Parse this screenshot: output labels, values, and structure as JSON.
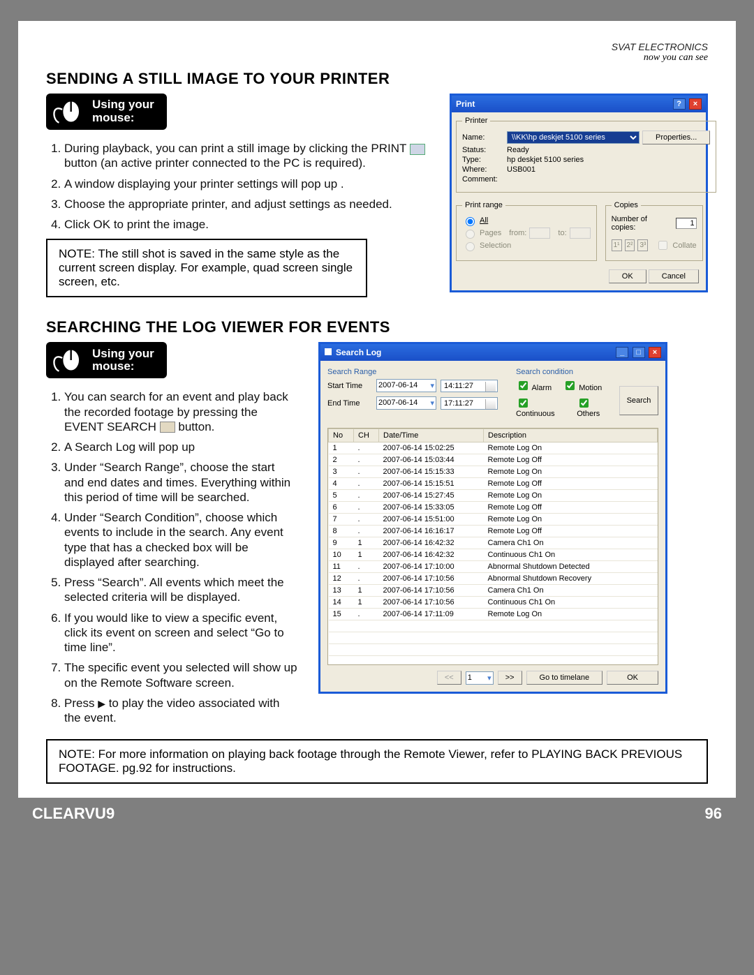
{
  "brand": {
    "name": "SVAT ELECTRONICS",
    "tagline": "now you can see"
  },
  "mouse_label": "Using your\nmouse:",
  "section1": {
    "title": "SENDING A STILL IMAGE TO YOUR PRINTER",
    "steps": [
      "During playback, you can print a still image by clicking the PRINT  ⧉  button (an active printer connected to the PC is required).",
      "A window displaying your printer settings will pop up .",
      "Choose the appropriate printer, and adjust settings as needed.",
      "Click OK to print the image."
    ],
    "note": "NOTE:  The still shot is saved in the same style as the current screen display.  For example, quad screen single screen, etc."
  },
  "section2": {
    "title": "SEARCHING THE LOG VIEWER FOR EVENTS",
    "steps": [
      "You can search for an event and play back the recorded footage by pressing the EVENT SEARCH  ⧉  button.",
      "A Search Log will pop up",
      "Under “Search Range”, choose the start and end dates and times.  Everything within this period of time will be searched.",
      "Under “Search Condition”, choose which events to include in the search.  Any event type that has a checked box will be displayed after searching.",
      "Press “Search”.  All events which meet the selected criteria will be displayed.",
      "If you would like to view a specific event, click its event on screen and select “Go to time line”.",
      "The specific event you selected will show up on the Remote Software screen.",
      "Press ▶ to play the video associated with the event."
    ],
    "note": "NOTE:  For more information on playing back footage through the Remote Viewer, refer to PLAYING BACK PREVIOUS FOOTAGE. pg.92 for instructions."
  },
  "print_dialog": {
    "title": "Print",
    "printer_legend": "Printer",
    "name_label": "Name:",
    "name_value": "\\\\KK\\hp deskjet 5100 series",
    "properties": "Properties...",
    "status_label": "Status:",
    "status_value": "Ready",
    "type_label": "Type:",
    "type_value": "hp deskjet 5100 series",
    "where_label": "Where:",
    "where_value": "USB001",
    "comment_label": "Comment:",
    "range_legend": "Print range",
    "all": "All",
    "pages": "Pages",
    "from": "from:",
    "to": "to:",
    "selection": "Selection",
    "copies_legend": "Copies",
    "num_copies": "Number of copies:",
    "copies_val": "1",
    "collate": "Collate",
    "ok": "OK",
    "cancel": "Cancel"
  },
  "search_dialog": {
    "title": "Search Log",
    "range_head": "Search Range",
    "cond_head": "Search condition",
    "start": "Start Time",
    "end": "End Time",
    "start_date": "2007-06-14",
    "start_time": "14:11:27",
    "end_date": "2007-06-14",
    "end_time": "17:11:27",
    "alarm": "Alarm",
    "motion": "Motion",
    "continuous": "Continuous",
    "others": "Others",
    "search_btn": "Search",
    "cols": {
      "no": "No",
      "ch": "CH",
      "dt": "Date/Time",
      "desc": "Description"
    },
    "rows": [
      {
        "no": "1",
        "ch": ".",
        "dt": "2007-06-14 15:02:25",
        "desc": "Remote Log On"
      },
      {
        "no": "2",
        "ch": ".",
        "dt": "2007-06-14 15:03:44",
        "desc": "Remote Log Off"
      },
      {
        "no": "3",
        "ch": ".",
        "dt": "2007-06-14 15:15:33",
        "desc": "Remote Log On"
      },
      {
        "no": "4",
        "ch": ".",
        "dt": "2007-06-14 15:15:51",
        "desc": "Remote Log Off"
      },
      {
        "no": "5",
        "ch": ".",
        "dt": "2007-06-14 15:27:45",
        "desc": "Remote Log On"
      },
      {
        "no": "6",
        "ch": ".",
        "dt": "2007-06-14 15:33:05",
        "desc": "Remote Log Off"
      },
      {
        "no": "7",
        "ch": ".",
        "dt": "2007-06-14 15:51:00",
        "desc": "Remote Log On"
      },
      {
        "no": "8",
        "ch": ".",
        "dt": "2007-06-14 16:16:17",
        "desc": "Remote Log Off"
      },
      {
        "no": "9",
        "ch": "1",
        "dt": "2007-06-14 16:42:32",
        "desc": "Camera Ch1 On"
      },
      {
        "no": "10",
        "ch": "1",
        "dt": "2007-06-14 16:42:32",
        "desc": "Continuous Ch1 On"
      },
      {
        "no": "11",
        "ch": ".",
        "dt": "2007-06-14 17:10:00",
        "desc": "Abnormal Shutdown Detected"
      },
      {
        "no": "12",
        "ch": ".",
        "dt": "2007-06-14 17:10:56",
        "desc": "Abnormal Shutdown Recovery"
      },
      {
        "no": "13",
        "ch": "1",
        "dt": "2007-06-14 17:10:56",
        "desc": "Camera Ch1 On"
      },
      {
        "no": "14",
        "ch": "1",
        "dt": "2007-06-14 17:10:56",
        "desc": "Continuous Ch1 On"
      },
      {
        "no": "15",
        "ch": ".",
        "dt": "2007-06-14 17:11:09",
        "desc": "Remote Log On"
      }
    ],
    "page": "1",
    "prev": "<<",
    "next": ">>",
    "goto": "Go to timelane",
    "ok": "OK"
  },
  "footer": {
    "model": "CLEARVU9",
    "page": "96"
  }
}
